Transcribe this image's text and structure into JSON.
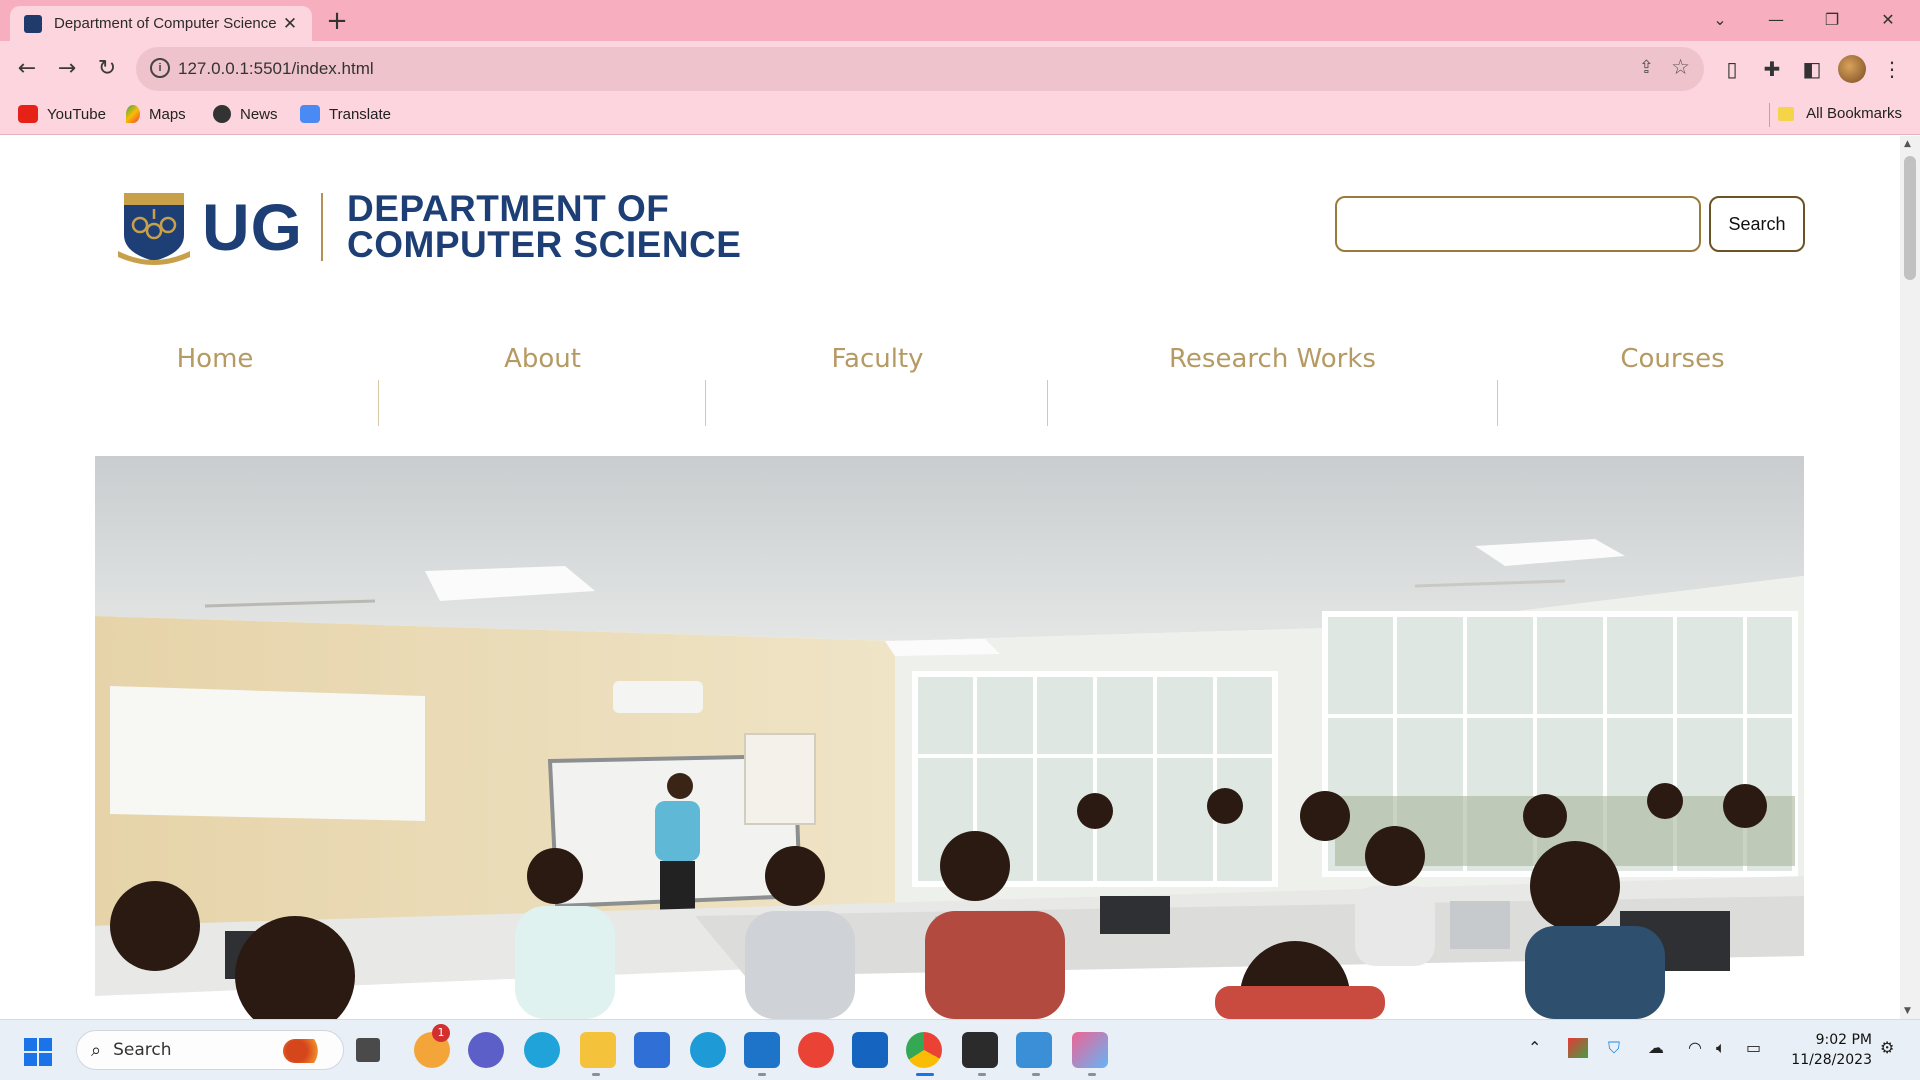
{
  "browser": {
    "tab_title": "Department of Computer Science",
    "url": "127.0.0.1:5501/index.html",
    "bookmarks": [
      {
        "label": "YouTube",
        "icon": "youtube-icon"
      },
      {
        "label": "Maps",
        "icon": "maps-icon"
      },
      {
        "label": "News",
        "icon": "news-icon"
      },
      {
        "label": "Translate",
        "icon": "translate-icon"
      }
    ],
    "all_bookmarks": "All Bookmarks"
  },
  "header": {
    "logo_text": "UG",
    "dept_line1": "DEPARTMENT OF",
    "dept_line2": "COMPUTER SCIENCE",
    "search_placeholder": "",
    "search_button": "Search"
  },
  "nav": [
    {
      "label": "Home"
    },
    {
      "label": "About"
    },
    {
      "label": "Faculty"
    },
    {
      "label": "Research Works"
    },
    {
      "label": "Courses"
    }
  ],
  "colors": {
    "brand_blue": "#1d3f76",
    "gold": "#b59a63",
    "chrome_pink": "#f7afbf"
  },
  "taskbar": {
    "search_label": "Search",
    "time": "9:02 PM",
    "date": "11/28/2023",
    "notification_badge": "1"
  }
}
